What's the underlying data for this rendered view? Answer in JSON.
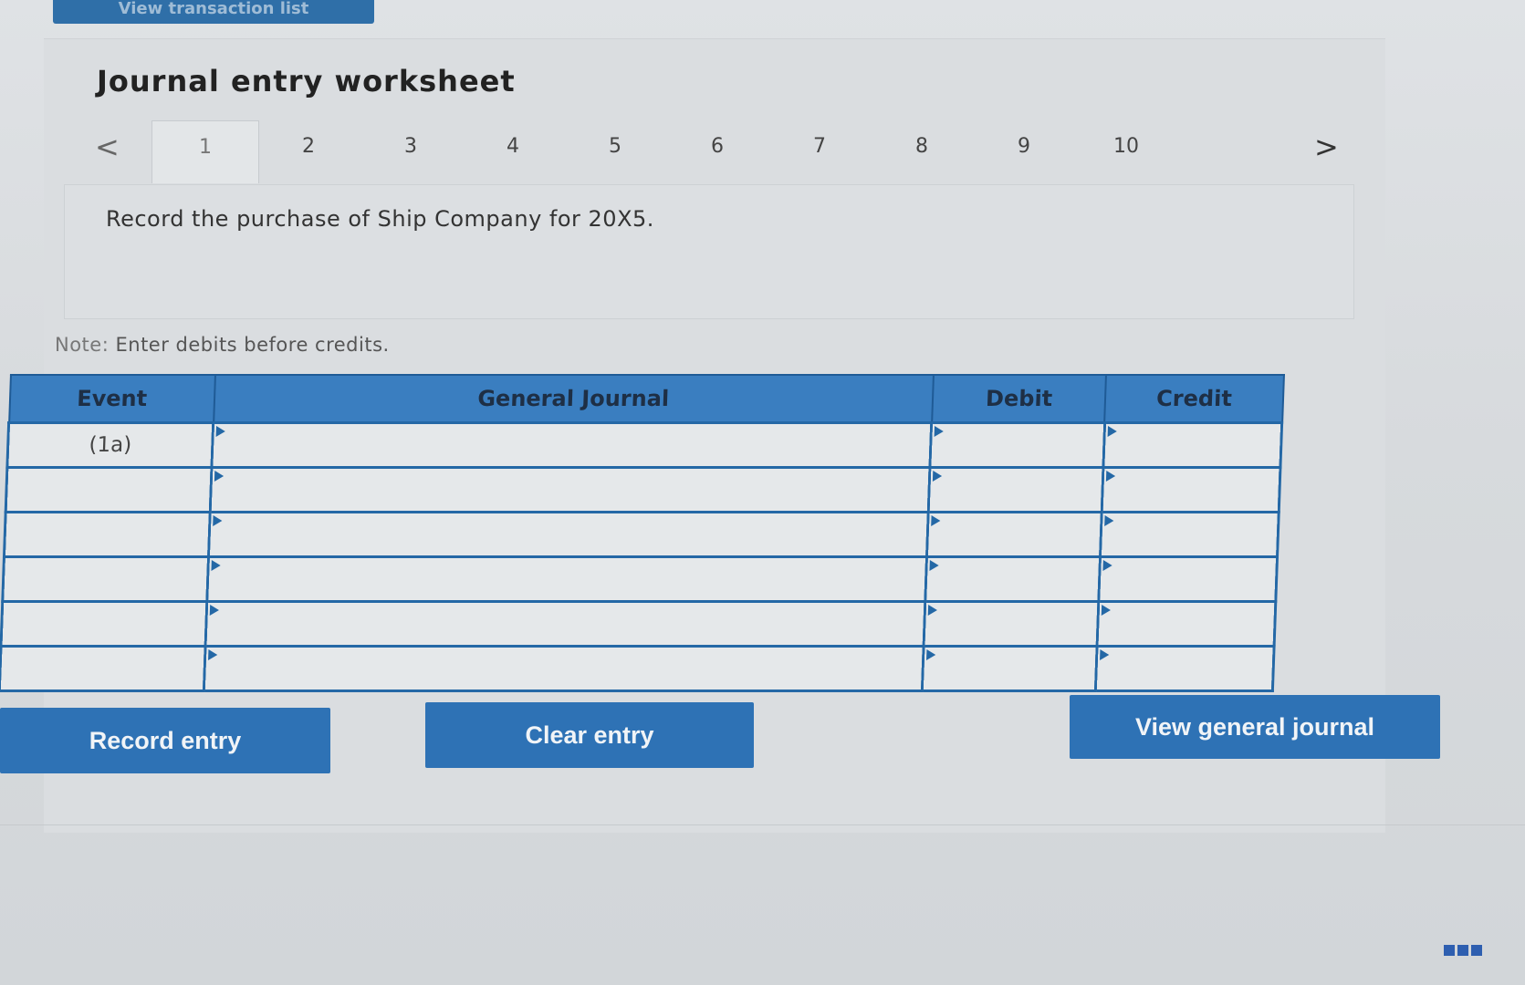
{
  "top_button": {
    "label": "View transaction list"
  },
  "title": "Journal entry worksheet",
  "tabs": {
    "prev": "<",
    "next": ">",
    "items": [
      "1",
      "2",
      "3",
      "4",
      "5",
      "6",
      "7",
      "8",
      "9",
      "10"
    ],
    "active_index": 0
  },
  "prompt": "Record the purchase of Ship Company for 20X5.",
  "note": {
    "prefix": "Note:",
    "text": "Enter debits before credits."
  },
  "table": {
    "columns": [
      "Event",
      "General Journal",
      "Debit",
      "Credit"
    ],
    "rows": [
      {
        "event": "(1a)",
        "account": "",
        "debit": "",
        "credit": ""
      },
      {
        "event": "",
        "account": "",
        "debit": "",
        "credit": ""
      },
      {
        "event": "",
        "account": "",
        "debit": "",
        "credit": ""
      },
      {
        "event": "",
        "account": "",
        "debit": "",
        "credit": ""
      },
      {
        "event": "",
        "account": "",
        "debit": "",
        "credit": ""
      },
      {
        "event": "",
        "account": "",
        "debit": "",
        "credit": ""
      }
    ]
  },
  "buttons": {
    "record": "Record entry",
    "clear": "Clear entry",
    "view": "View general journal"
  },
  "colors": {
    "accent": "#2e72b5",
    "table_border": "#2468a6"
  }
}
